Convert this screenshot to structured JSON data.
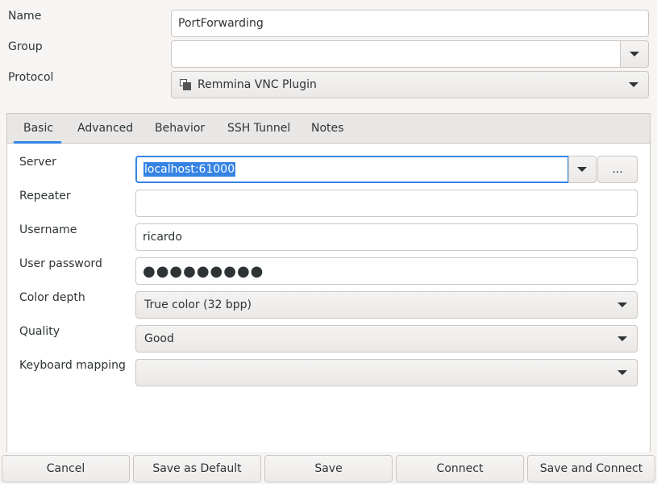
{
  "top": {
    "name_label": "Name",
    "name_value": "PortForwarding",
    "group_label": "Group",
    "group_value": "",
    "protocol_label": "Protocol",
    "protocol_value": "Remmina VNC Plugin",
    "protocol_icon": "vnc-plugin-icon"
  },
  "tabs": [
    "Basic",
    "Advanced",
    "Behavior",
    "SSH Tunnel",
    "Notes"
  ],
  "active_tab": "Basic",
  "basic": {
    "server_label": "Server",
    "server_value": "localhost:61000",
    "server_more_button": "...",
    "repeater_label": "Repeater",
    "repeater_value": "",
    "username_label": "Username",
    "username_value": "ricardo",
    "password_label": "User password",
    "password_value": "●●●●●●●●●",
    "color_depth_label": "Color depth",
    "color_depth_value": "True color (32 bpp)",
    "quality_label": "Quality",
    "quality_value": "Good",
    "keyboard_label": "Keyboard mapping",
    "keyboard_value": ""
  },
  "buttons": {
    "cancel": "Cancel",
    "save_default": "Save as Default",
    "save": "Save",
    "connect": "Connect",
    "save_connect": "Save and Connect"
  },
  "colors": {
    "accent": "#3584e4",
    "background": "#f6f5f4"
  }
}
